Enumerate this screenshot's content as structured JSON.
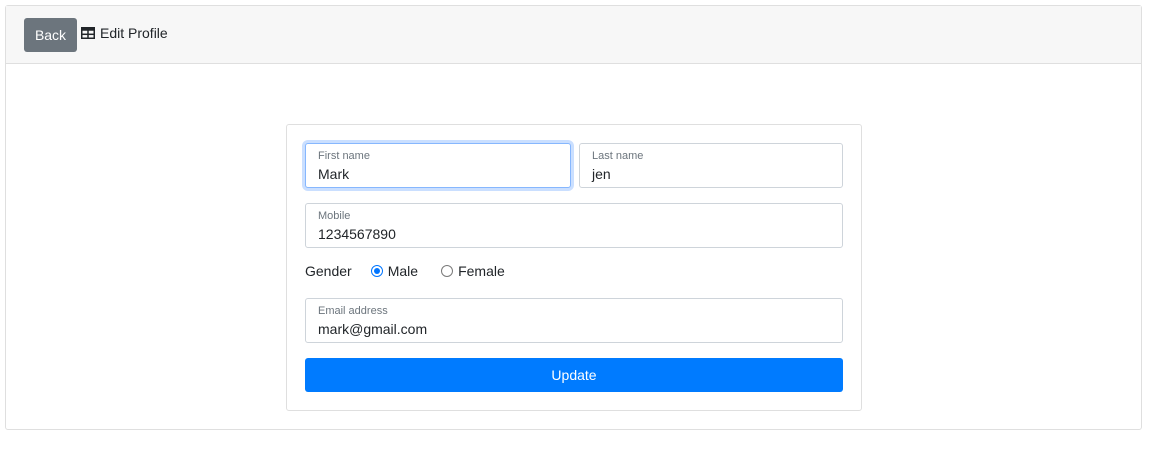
{
  "header": {
    "back_label": "Back",
    "title": "Edit Profile",
    "title_icon": "table-icon"
  },
  "form": {
    "first_name": {
      "label": "First name",
      "value": "Mark"
    },
    "last_name": {
      "label": "Last name",
      "value": "jen"
    },
    "mobile": {
      "label": "Mobile",
      "value": "1234567890"
    },
    "gender": {
      "label": "Gender",
      "options": [
        {
          "label": "Male",
          "checked": true
        },
        {
          "label": "Female",
          "checked": false
        }
      ]
    },
    "email": {
      "label": "Email address",
      "value": "mark@gmail.com"
    },
    "submit_label": "Update"
  },
  "colors": {
    "primary": "#007bff",
    "secondary": "#6c757d",
    "focus": "#86b7fe"
  }
}
